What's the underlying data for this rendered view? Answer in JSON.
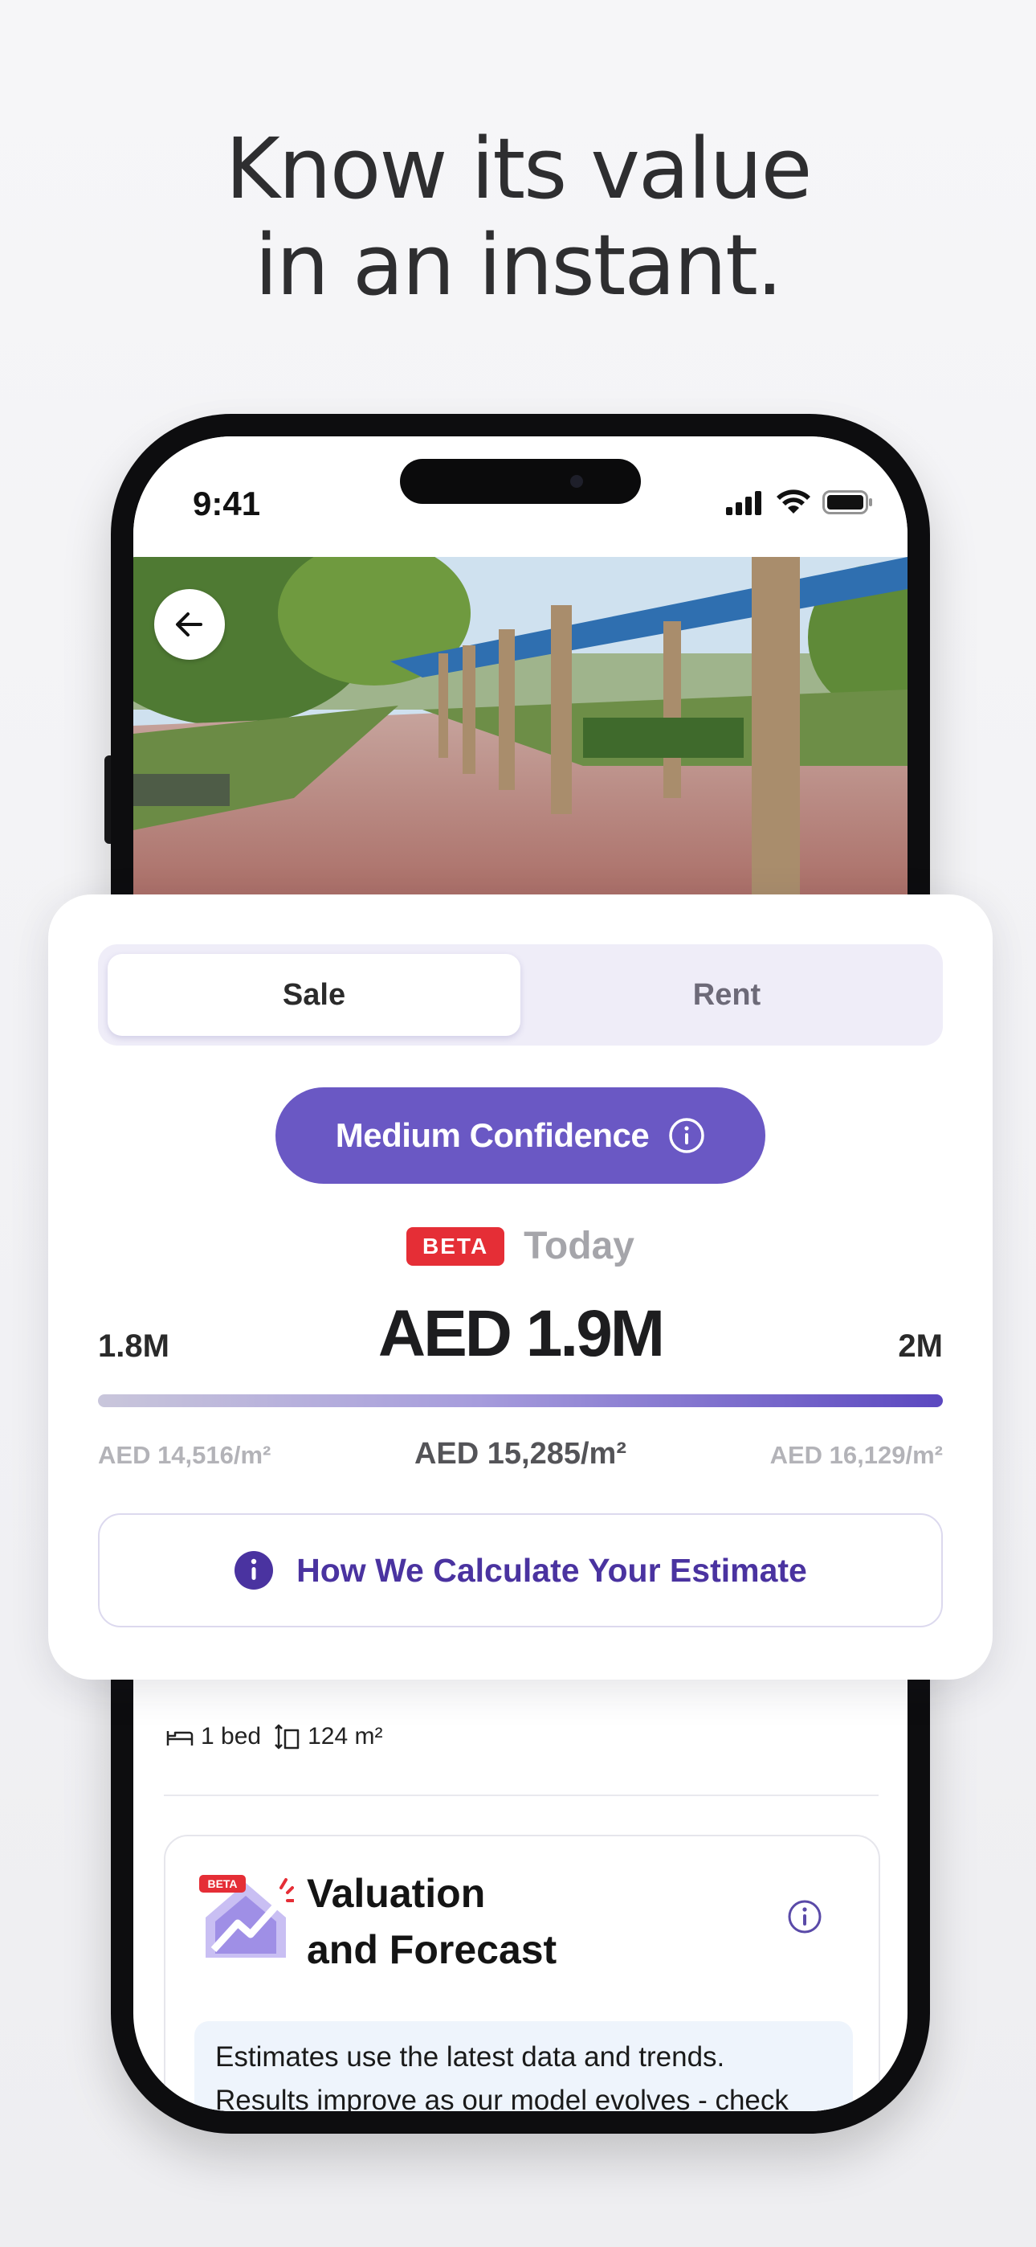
{
  "headline": {
    "line1": "Know its value",
    "line2": "in an instant."
  },
  "status_bar": {
    "time": "9:41"
  },
  "estimate": {
    "tabs": {
      "sale": "Sale",
      "rent": "Rent",
      "selected": "Sale"
    },
    "confidence_label": "Medium Confidence",
    "beta_badge": "BETA",
    "period": "Today",
    "range": {
      "low": "1.8M",
      "mid": "AED 1.9M",
      "high": "2M"
    },
    "per_sqm": {
      "low": "AED 14,516/m²",
      "mid": "AED 15,285/m²",
      "high": "AED 16,129/m²"
    },
    "how_button": "How We Calculate Your Estimate"
  },
  "property": {
    "beds": "1 bed",
    "area": "124 m²"
  },
  "valuation_card": {
    "badge": "BETA",
    "title_line1": "Valuation",
    "title_line2": "and Forecast",
    "note_line1": "Estimates use the latest data and trends.",
    "note_line2": "Results improve as our model evolves - check"
  },
  "colors": {
    "accent": "#6a58c4",
    "beta_red": "#e52e36",
    "link_purple": "#4a33a0"
  }
}
